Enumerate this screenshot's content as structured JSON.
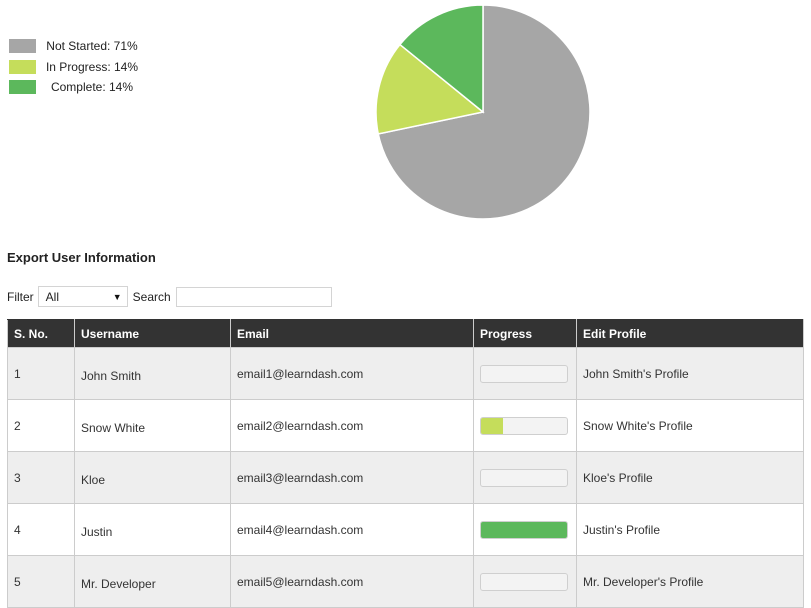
{
  "chart_data": {
    "type": "pie",
    "title": "",
    "slices": [
      {
        "label": "Not Started",
        "value": 71,
        "color": "#a6a6a6"
      },
      {
        "label": "In Progress",
        "value": 14,
        "color": "#c5dd5b"
      },
      {
        "label": "Complete",
        "value": 14,
        "color": "#5cb85c"
      }
    ],
    "legend_position": "top-left",
    "legend": [
      {
        "label": "Not Started: 71%",
        "color": "#a6a6a6"
      },
      {
        "label": "In Progress: 14%",
        "color": "#c5dd5b"
      },
      {
        "label": "Complete: 14%",
        "color": "#5cb85c"
      }
    ]
  },
  "section": {
    "title": "Export User Information"
  },
  "filters": {
    "filter_label": "Filter",
    "filter_value": "All",
    "search_label": "Search",
    "search_value": "",
    "search_placeholder": ""
  },
  "table": {
    "headers": [
      "S. No.",
      "Username",
      "Email",
      "Progress",
      "Edit Profile"
    ],
    "rows": [
      {
        "sno": "1",
        "username": "John Smith",
        "email": "email1@learndash.com",
        "progress": 0,
        "progress_color": "#c5dd5b",
        "profile": "John Smith's Profile"
      },
      {
        "sno": "2",
        "username": "Snow White",
        "email": "email2@learndash.com",
        "progress": 25,
        "progress_color": "#c5dd5b",
        "profile": "Snow White's Profile"
      },
      {
        "sno": "3",
        "username": "Kloe",
        "email": "email3@learndash.com",
        "progress": 0,
        "progress_color": "#c5dd5b",
        "profile": "Kloe's Profile"
      },
      {
        "sno": "4",
        "username": "Justin",
        "email": "email4@learndash.com",
        "progress": 100,
        "progress_color": "#5cb85c",
        "profile": "Justin's Profile"
      },
      {
        "sno": "5",
        "username": "Mr. Developer",
        "email": "email5@learndash.com",
        "progress": 0,
        "progress_color": "#c5dd5b",
        "profile": "Mr. Developer's Profile"
      }
    ]
  }
}
